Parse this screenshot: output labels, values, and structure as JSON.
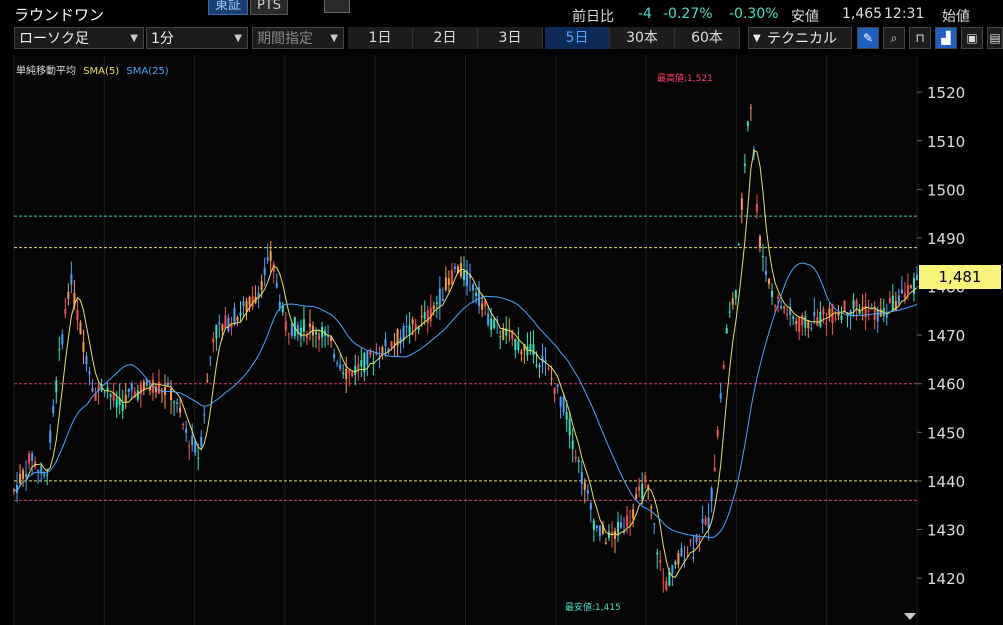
{
  "header": {
    "stock_name": "ラウンドワン",
    "market_tabs": [
      {
        "label": "東証",
        "active": true
      },
      {
        "label": "PTS",
        "active": false
      }
    ],
    "quote": {
      "prev_label": "前日比",
      "change": "-4",
      "change_pct": "-0.27%",
      "change_pct2": "-0.30%",
      "low_label": "安値",
      "low_value": "1,465",
      "time": "12:31",
      "open_label": "始値"
    }
  },
  "toolbar": {
    "chart_type": "ローソク足",
    "interval": "1分",
    "period_placeholder": "期間指定",
    "timeframes": [
      {
        "label": "1日"
      },
      {
        "label": "2日"
      },
      {
        "label": "3日"
      },
      {
        "label": "5日",
        "selected": true
      },
      {
        "label": "30本"
      },
      {
        "label": "60本"
      }
    ],
    "technical_label": "テクニカル",
    "icons": [
      "pen-icon",
      "zoom-icon",
      "out-icon",
      "area-chart-icon",
      "calendar-icon"
    ]
  },
  "chart_data": {
    "type": "candlestick",
    "legend": {
      "title": "単純移動平均",
      "series": [
        {
          "name": "SMA(5)",
          "color": "#e8e05a"
        },
        {
          "name": "SMA(25)",
          "color": "#4aa3ff"
        }
      ]
    },
    "y_ticks": [
      1520,
      1510,
      1500,
      1490,
      1480,
      1470,
      1460,
      1450,
      1440,
      1430,
      1420
    ],
    "y_range": [
      1412,
      1526
    ],
    "current_price_label": "1,481",
    "high_label": "最高値:1,521",
    "low_label": "最安値:1,415",
    "h_lines": [
      {
        "value": 1494.5,
        "color": "#3ec9c9"
      },
      {
        "value": 1488,
        "color": "#e8e05a"
      },
      {
        "value": 1460,
        "color": "#d33a7a"
      },
      {
        "value": 1440,
        "color": "#e8e05a"
      },
      {
        "value": 1436,
        "color": "#d33a7a"
      }
    ],
    "price_path": [
      [
        0,
        1438
      ],
      [
        0.02,
        1445
      ],
      [
        0.035,
        1440
      ],
      [
        0.05,
        1465
      ],
      [
        0.062,
        1482
      ],
      [
        0.075,
        1470
      ],
      [
        0.09,
        1458
      ],
      [
        0.1,
        1460
      ],
      [
        0.115,
        1455
      ],
      [
        0.13,
        1458
      ],
      [
        0.155,
        1460
      ],
      [
        0.175,
        1458
      ],
      [
        0.19,
        1450
      ],
      [
        0.205,
        1445
      ],
      [
        0.22,
        1470
      ],
      [
        0.245,
        1474
      ],
      [
        0.265,
        1477
      ],
      [
        0.285,
        1486
      ],
      [
        0.3,
        1472
      ],
      [
        0.34,
        1471
      ],
      [
        0.37,
        1462
      ],
      [
        0.4,
        1466
      ],
      [
        0.43,
        1470
      ],
      [
        0.46,
        1474
      ],
      [
        0.49,
        1484
      ],
      [
        0.51,
        1480
      ],
      [
        0.53,
        1472
      ],
      [
        0.56,
        1468
      ],
      [
        0.585,
        1465
      ],
      [
        0.61,
        1455
      ],
      [
        0.63,
        1440
      ],
      [
        0.645,
        1430
      ],
      [
        0.66,
        1428
      ],
      [
        0.68,
        1432
      ],
      [
        0.7,
        1440
      ],
      [
        0.72,
        1418
      ],
      [
        0.74,
        1425
      ],
      [
        0.77,
        1432
      ],
      [
        0.79,
        1472
      ],
      [
        0.8,
        1480
      ],
      [
        0.815,
        1521
      ],
      [
        0.825,
        1490
      ],
      [
        0.84,
        1478
      ],
      [
        0.87,
        1472
      ],
      [
        0.9,
        1474
      ],
      [
        0.93,
        1476
      ],
      [
        0.96,
        1474
      ],
      [
        1,
        1481
      ]
    ]
  }
}
